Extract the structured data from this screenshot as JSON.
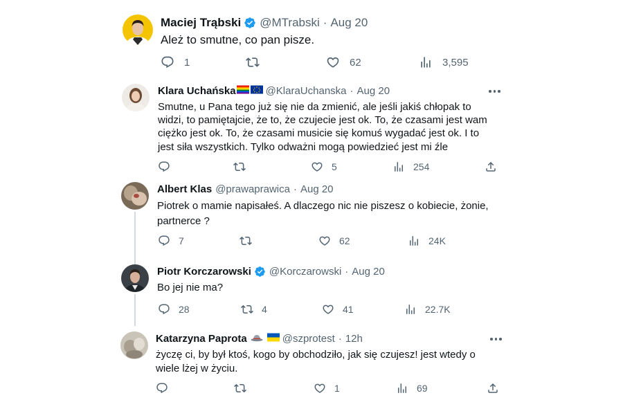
{
  "tweets": [
    {
      "name": "Maciej Trąbski",
      "handle": "@MTrabski",
      "time": "Aug 20",
      "text": "Ależ to smutne, co pan pisze.",
      "replies": "1",
      "retweets": "",
      "likes": "62",
      "views": "3,595"
    },
    {
      "name": "Klara Uchańska",
      "handle": "@KlaraUchanska",
      "time": "Aug 20",
      "text": "Smutne, u Pana tego już się nie da zmienić, ale jeśli jakiś chłopak to widzi, to pamiętajcie, że to, że czujecie jest ok. To, że czasami jest wam ciężko jest ok. To, że czasami musicie się komuś wygadać jest ok. I to jest siła wszystkich. Tylko odważni mogą powiedzieć jest mi źle",
      "replies": "",
      "retweets": "",
      "likes": "5",
      "views": "254"
    },
    {
      "name": "Albert Klas",
      "handle": "@prawaprawica",
      "time": "Aug 20",
      "text": "Piotrek o mamie napisałeś. A dlaczego nic nie piszesz o kobiecie, żonie, partnerce ?",
      "replies": "7",
      "retweets": "",
      "likes": "62",
      "views": "24K"
    },
    {
      "name": "Piotr Korczarowski",
      "handle": "@Korczarowski",
      "time": "Aug 20",
      "text": "Bo jej nie ma?",
      "replies": "28",
      "retweets": "4",
      "likes": "41",
      "views": "22.7K"
    },
    {
      "name": "Katarzyna Paprota",
      "handle": "@szprotest",
      "time": "12h",
      "text": "życzę ci, by był ktoś, kogo by obchodziło, jak się czujesz! jest wtedy o wiele lżej w życiu.",
      "replies": "",
      "retweets": "",
      "likes": "1",
      "views": "69"
    }
  ],
  "separator": "·",
  "icons": [
    "verified-badge-icon",
    "reply-icon",
    "retweet-icon",
    "like-icon",
    "views-icon",
    "share-icon",
    "more-icon",
    "rainbow-flag-icon",
    "eu-flag-icon",
    "hat-icon",
    "ukraine-flag-icon"
  ],
  "colors": {
    "verified": "#1d9bf0",
    "muted": "#536471",
    "text": "#0f1419",
    "thread_line": "#cfd9de"
  }
}
